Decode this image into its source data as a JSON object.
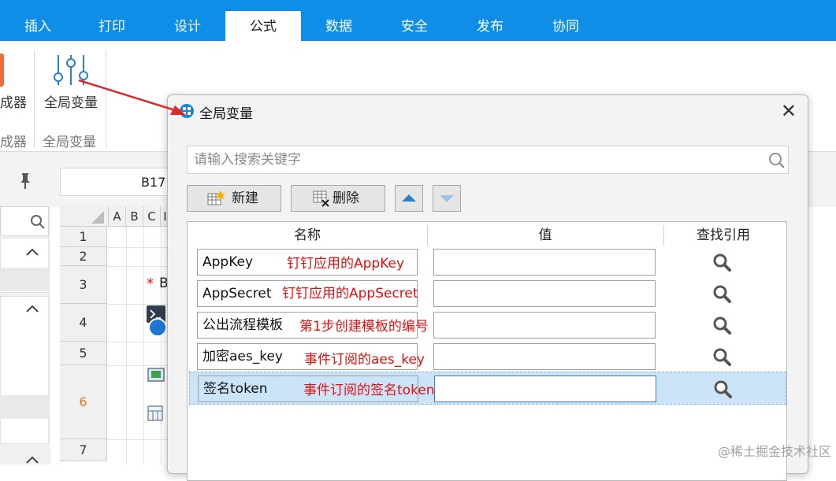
{
  "tabs": [
    "插入",
    "打印",
    "设计",
    "公式",
    "数据",
    "安全",
    "发布",
    "协同"
  ],
  "active_tab": "公式",
  "ribbon": {
    "left_cut_label": "成器",
    "left_cut_group": "成器",
    "global_var_label": "全局变量",
    "global_var_group": "全局变量"
  },
  "cell_ref": "B17",
  "sheet": {
    "columns": [
      "A",
      "B",
      "C",
      "I"
    ],
    "rows": [
      "1",
      "2",
      "3",
      "4",
      "5",
      "6",
      "7"
    ],
    "row3_marker": "*",
    "row3_text": "B"
  },
  "dialog": {
    "title": "全局变量",
    "search_placeholder": "请输入搜索关键字",
    "buttons": {
      "new": "新建",
      "delete": "删除"
    },
    "columns": {
      "name": "名称",
      "value": "值",
      "ref": "查找引用"
    },
    "rows": [
      {
        "name": "AppKey",
        "annotation": "钉钉应用的AppKey",
        "value": ""
      },
      {
        "name": "AppSecret",
        "annotation": "钉钉应用的AppSecret",
        "value": ""
      },
      {
        "name": "公出流程模板",
        "annotation": "第1步创建模板的编号",
        "value": ""
      },
      {
        "name": "加密aes_key",
        "annotation": "事件订阅的aes_key",
        "value": ""
      },
      {
        "name": "签名token",
        "annotation": "事件订阅的签名token",
        "value": ""
      }
    ],
    "selected_row": 4
  },
  "watermark": "@稀土掘金技术社区",
  "colors": {
    "tabbar": "#0e8ee6",
    "annotation": "#e01010",
    "selected_row": "#cce4f7",
    "arrow": "#d92b2b"
  }
}
